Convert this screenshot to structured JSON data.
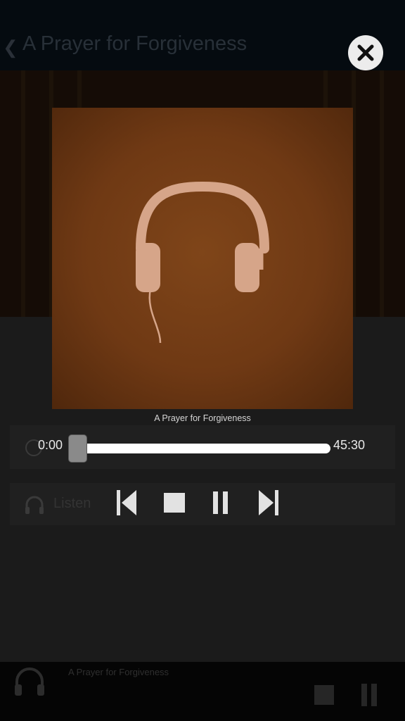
{
  "background": {
    "title": "A Prayer for Forgiveness",
    "listen_label": "Listen"
  },
  "modal": {
    "caption": "A Prayer for Forgiveness",
    "time_current": "0:00",
    "time_total": "45:30",
    "progress_fraction": 0.0
  },
  "mini_player": {
    "title": "A Prayer for Forgiveness"
  },
  "colors": {
    "artwork_bg": "#6f3914",
    "headphones": "#d6a589",
    "track": "#ffffff",
    "controls": "#e2e2e2"
  }
}
